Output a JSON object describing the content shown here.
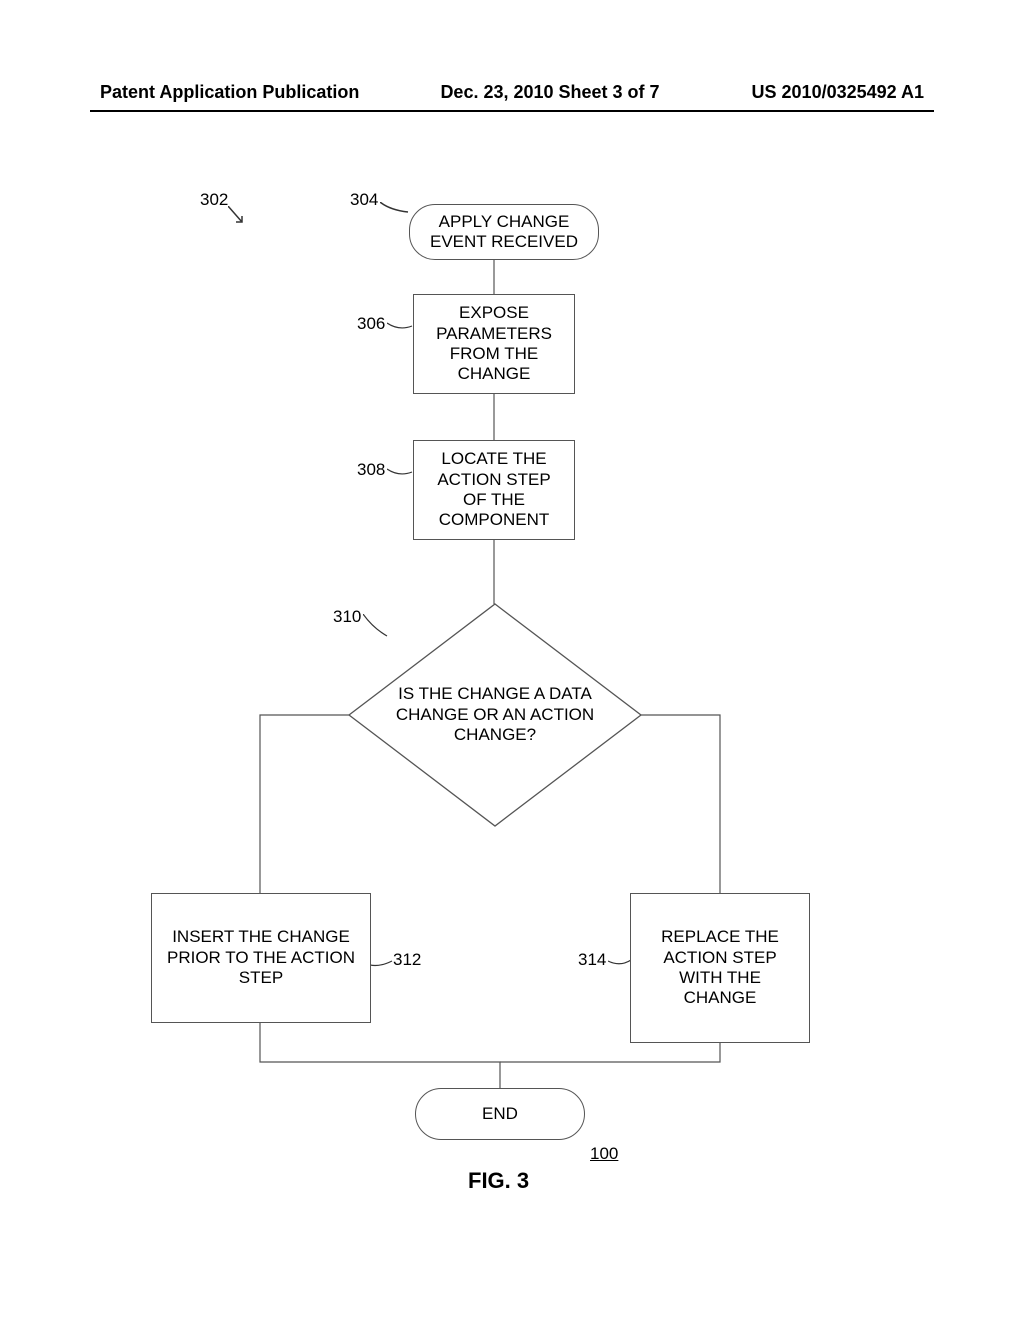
{
  "header": {
    "left": "Patent Application Publication",
    "center": "Dec. 23, 2010  Sheet 3 of 7",
    "right": "US 2010/0325492 A1"
  },
  "labels": {
    "flow_ref": "302",
    "start_ref": "304",
    "expose_ref": "306",
    "locate_ref": "308",
    "decision_ref": "310",
    "insert_ref": "312",
    "replace_ref": "314",
    "figure_num": "100"
  },
  "nodes": {
    "start": "APPLY CHANGE EVENT RECEIVED",
    "expose": "EXPOSE PARAMETERS FROM THE CHANGE",
    "locate": "LOCATE THE ACTION STEP OF THE COMPONENT",
    "decision": "IS THE CHANGE A DATA CHANGE OR AN ACTION CHANGE?",
    "insert": "INSERT THE CHANGE PRIOR TO THE ACTION STEP",
    "replace": "REPLACE THE ACTION STEP WITH THE CHANGE",
    "end": "END"
  },
  "figure_caption": "FIG. 3"
}
